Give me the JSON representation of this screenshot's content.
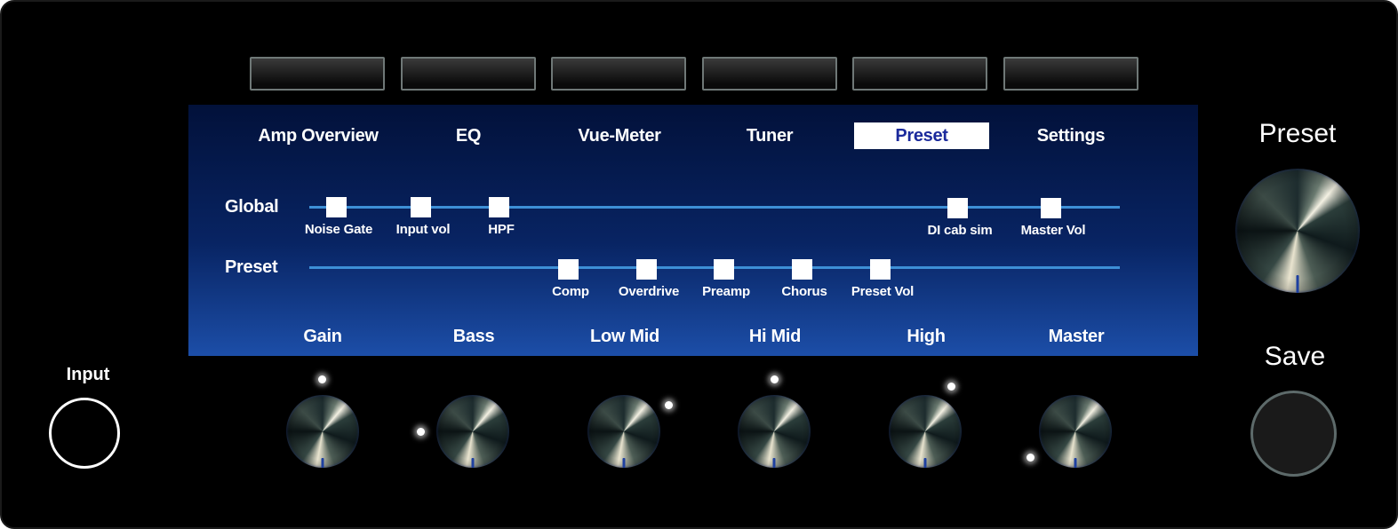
{
  "tabs": [
    {
      "label": "Amp Overview"
    },
    {
      "label": "EQ"
    },
    {
      "label": "Vue-Meter"
    },
    {
      "label": "Tuner"
    },
    {
      "label": "Preset",
      "active": true
    },
    {
      "label": "Settings"
    }
  ],
  "chain": {
    "global_label": "Global",
    "preset_label": "Preset",
    "global_nodes": [
      "Noise Gate",
      "Input vol",
      "HPF",
      "DI cab sim",
      "Master Vol"
    ],
    "preset_nodes": [
      "Comp",
      "Overdrive",
      "Preamp",
      "Chorus",
      "Preset Vol"
    ]
  },
  "knobs": [
    {
      "label": "Gain"
    },
    {
      "label": "Bass"
    },
    {
      "label": "Low Mid"
    },
    {
      "label": "Hi Mid"
    },
    {
      "label": "High"
    },
    {
      "label": "Master"
    }
  ],
  "side": {
    "preset_label": "Preset",
    "save_label": "Save",
    "input_label": "Input"
  },
  "colors": {
    "screen_top": "#02113a",
    "screen_bottom": "#1c4ea8",
    "track": "#3d8fd6",
    "active_tab_text": "#1b2a9c"
  }
}
